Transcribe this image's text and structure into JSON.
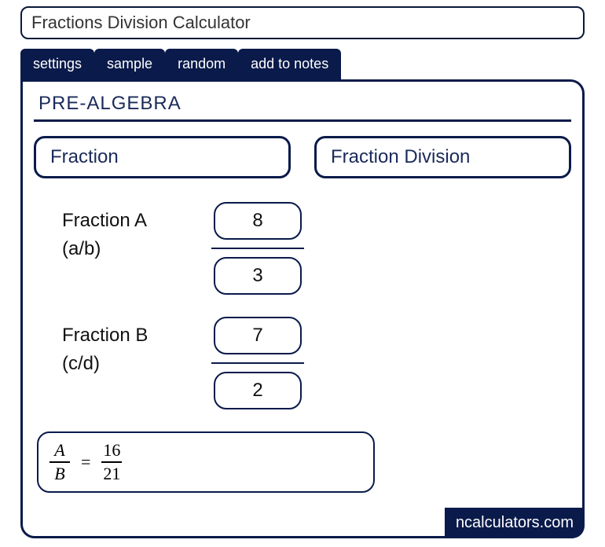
{
  "title": "Fractions Division Calculator",
  "tabs": [
    "settings",
    "sample",
    "random",
    "add to notes"
  ],
  "section": "PRE-ALGEBRA",
  "chips": [
    "Fraction",
    "Fraction Division"
  ],
  "fractionA": {
    "label": "Fraction A",
    "sub": "(a/b)",
    "numerator": "8",
    "denominator": "3"
  },
  "fractionB": {
    "label": "Fraction B",
    "sub": "(c/d)",
    "numerator": "7",
    "denominator": "2"
  },
  "result": {
    "leftTop": "A",
    "leftBottom": "B",
    "eq": "=",
    "rightTop": "16",
    "rightBottom": "21"
  },
  "brand": "ncalculators.com"
}
